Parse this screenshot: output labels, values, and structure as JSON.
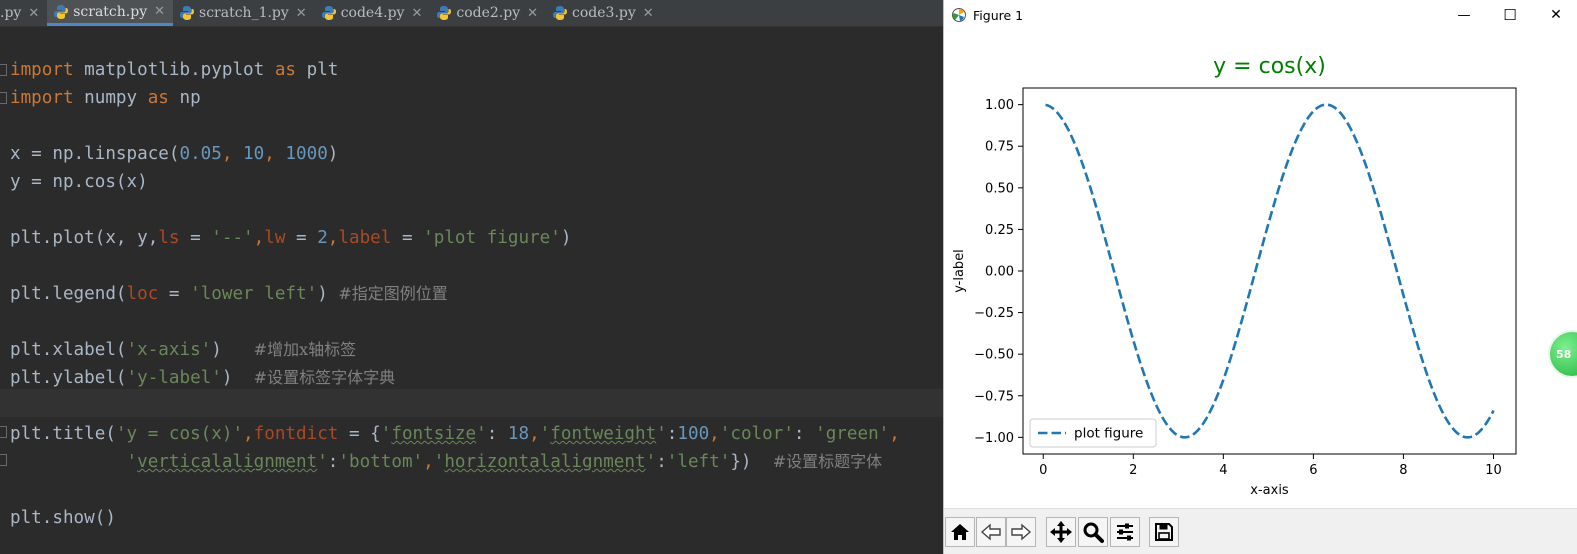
{
  "editor": {
    "tabs": [
      {
        "label": ".py",
        "active": false,
        "partial": true
      },
      {
        "label": "scratch.py",
        "active": true,
        "partial": false
      },
      {
        "label": "scratch_1.py",
        "active": false,
        "partial": false
      },
      {
        "label": "code4.py",
        "active": false,
        "partial": false
      },
      {
        "label": "code2.py",
        "active": false,
        "partial": false
      },
      {
        "label": "code3.py",
        "active": false,
        "partial": false
      }
    ],
    "close_glyph": "✕",
    "code": {
      "l1": {
        "kw1": "import",
        "mid": " matplotlib.pyplot ",
        "kw2": "as",
        "end": " plt"
      },
      "l2": {
        "kw1": "import",
        "mid": " numpy ",
        "kw2": "as",
        "end": " np"
      },
      "l3": {
        "a": "x = np.linspace(",
        "n1": "0.05",
        "c1": ", ",
        "n2": "10",
        "c2": ", ",
        "n3": "1000",
        "b": ")"
      },
      "l4": {
        "a": "y = np.cos(x)"
      },
      "l5": {
        "a": "plt.plot(x, y,",
        "p1": "ls",
        "e1": " = ",
        "s1": "'--'",
        "c1": ",",
        "p2": "lw",
        "e2": " = ",
        "n1": "2",
        "c2": ",",
        "p3": "label",
        "e3": " = ",
        "s2": "'plot figure'",
        "b": ")"
      },
      "l6": {
        "a": "plt.legend(",
        "p1": "loc",
        "e1": " = ",
        "s1": "'lower left'",
        "b": ") ",
        "cmt": "#指定图例位置"
      },
      "l7": {
        "a": "plt.xlabel(",
        "s1": "'x-axis'",
        "b": ")   ",
        "cmt": "#增加x轴标签"
      },
      "l8": {
        "a": "plt.ylabel(",
        "s1": "'y-label'",
        "b": ")  ",
        "cmt": "#设置标签字体字典"
      },
      "l9": {
        "a": "plt.title(",
        "s1": "'y = cos(x)'",
        "c1": ",",
        "p1": "fontdict",
        "e1": " = {",
        "q1": "'",
        "k1": "fontsize",
        "q2": "'",
        "c2": ": ",
        "n1": "18",
        "c3": ",",
        "q3": "'",
        "k2": "fontweight",
        "q4": "'",
        "c4": ":",
        "n2": "100",
        "c5": ",",
        "s2": "'color'",
        "c6": ": ",
        "s3": "'green'",
        "c7": ","
      },
      "l10": {
        "indent": "           ",
        "q1": "'",
        "k1": "verticalalignment",
        "q2": "'",
        "c1": ":",
        "s1": "'bottom'",
        "c2": ",",
        "q3": "'",
        "k2": "horizontalalignment",
        "q4": "'",
        "c3": ":",
        "s2": "'left'",
        "b": "})  ",
        "cmt": "#设置标题字体"
      },
      "l11": {
        "a": "plt.show()"
      }
    }
  },
  "figure": {
    "window_title": "Figure 1",
    "minimize": "—",
    "maximize": "☐",
    "close": "✕"
  },
  "badge": {
    "text": "58"
  },
  "colors": {
    "line": "#1f77b4",
    "title": "#008000",
    "keyword": "#cc7832",
    "string": "#6a8759",
    "number": "#6897bb",
    "param": "#aa4926",
    "comment": "#808080"
  },
  "chart_data": {
    "type": "line",
    "title": "y = cos(x)",
    "xlabel": "x-axis",
    "ylabel": "y-label",
    "xlim": [
      -0.45,
      10.5
    ],
    "ylim": [
      -1.1,
      1.1
    ],
    "x_ticks": [
      0,
      2,
      4,
      6,
      8,
      10
    ],
    "x_tick_labels": [
      "0",
      "2",
      "4",
      "6",
      "8",
      "10"
    ],
    "y_ticks": [
      1.0,
      0.75,
      0.5,
      0.25,
      0.0,
      -0.25,
      -0.5,
      -0.75,
      -1.0
    ],
    "y_tick_labels": [
      "1.00",
      "0.75",
      "0.50",
      "0.25",
      "0.00",
      "−0.25",
      "−0.50",
      "−0.75",
      "−1.00"
    ],
    "grid": false,
    "legend_position": "lower-left",
    "series": [
      {
        "name": "plot figure",
        "style": "dashed",
        "color": "#1f77b4",
        "x": [
          0.05,
          0.5,
          1.0,
          1.5,
          2.0,
          2.5,
          3.0,
          3.14,
          3.5,
          4.0,
          4.5,
          5.0,
          5.5,
          6.0,
          6.28,
          6.5,
          7.0,
          7.5,
          8.0,
          8.5,
          9.0,
          9.42,
          9.5,
          10.0
        ],
        "y": [
          1.0,
          0.88,
          0.54,
          0.07,
          -0.42,
          -0.8,
          -0.99,
          -1.0,
          -0.94,
          -0.65,
          -0.21,
          0.28,
          0.71,
          0.96,
          1.0,
          0.98,
          0.75,
          0.35,
          -0.15,
          -0.6,
          -0.91,
          -1.0,
          -1.0,
          -0.84
        ]
      }
    ]
  }
}
